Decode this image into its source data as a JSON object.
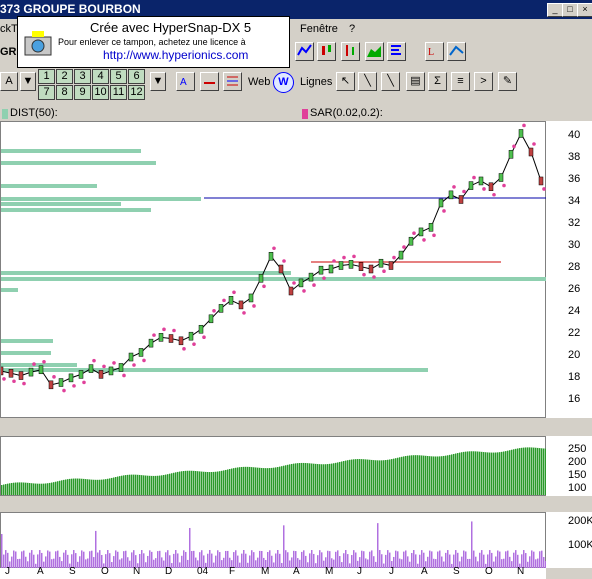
{
  "window": {
    "title": "373 GROUPE BOURBON",
    "buttons": [
      "_",
      "□",
      "×"
    ]
  },
  "menu": {
    "items": [
      "ckT",
      "Fenêtre",
      "?"
    ]
  },
  "stamp": {
    "line1": "Crée avec HyperSnap-DX 5",
    "line2": "Pour enlever ce tampon, achetez une licence à",
    "line3": "http://www.hyperionics.com"
  },
  "toolbar": {
    "left_label": "GR",
    "a_label": "A",
    "numbers_row1": [
      "1",
      "2",
      "3",
      "4",
      "5",
      "6"
    ],
    "numbers_row2": [
      "7",
      "8",
      "9",
      "10",
      "11",
      "12"
    ],
    "web_label": "Web",
    "lines_label": "Lignes"
  },
  "indicators": {
    "left": "DIST(50):",
    "right": "SAR(0.02,0.2):",
    "left_color": "#8fd0b0",
    "right_color": "#e0409a"
  },
  "price_axis": [
    "40",
    "38",
    "36",
    "34",
    "32",
    "30",
    "28",
    "26",
    "24",
    "22",
    "20",
    "18",
    "16"
  ],
  "rsi_axis": [
    "250",
    "200",
    "150",
    "100"
  ],
  "vol_axis": [
    "200K",
    "100K"
  ],
  "month_axis": [
    "J",
    "A",
    "S",
    "O",
    "N",
    "D",
    "04",
    "F",
    "M",
    "A",
    "M",
    "J",
    "J",
    "A",
    "S",
    "O",
    "N"
  ],
  "chart_data": {
    "type": "line",
    "title": "",
    "ylim": [
      15,
      41
    ],
    "x": [
      0,
      10,
      20,
      30,
      40,
      50,
      60,
      70,
      80,
      90,
      100,
      110,
      120,
      130,
      140,
      150,
      160,
      170,
      180,
      190,
      200,
      210,
      220,
      230,
      240,
      250,
      260,
      270,
      280,
      290,
      300,
      310,
      320,
      330,
      340,
      350,
      360,
      370,
      380,
      390,
      400,
      410,
      420,
      430,
      440,
      450,
      460,
      470,
      480,
      490,
      500,
      510,
      520,
      530,
      540
    ],
    "series": [
      {
        "values": [
          19.2,
          19,
          18.8,
          19.1,
          19.3,
          18,
          18.2,
          18.6,
          18.9,
          19.4,
          18.9,
          19.2,
          19.5,
          20.4,
          20.8,
          21.6,
          22.1,
          22.0,
          21.8,
          22.2,
          22.8,
          23.7,
          24.6,
          25.3,
          24.9,
          25.5,
          27.2,
          29.1,
          28.0,
          26.1,
          26.8,
          27.3,
          27.9,
          28.0,
          28.3,
          28.4,
          28.2,
          28.0,
          28.5,
          28.3,
          29.2,
          30.4,
          31.2,
          31.6,
          33.7,
          34.4,
          34.0,
          35.2,
          35.6,
          35.1,
          35.9,
          37.9,
          39.7,
          38.1,
          35.6
        ]
      }
    ]
  }
}
